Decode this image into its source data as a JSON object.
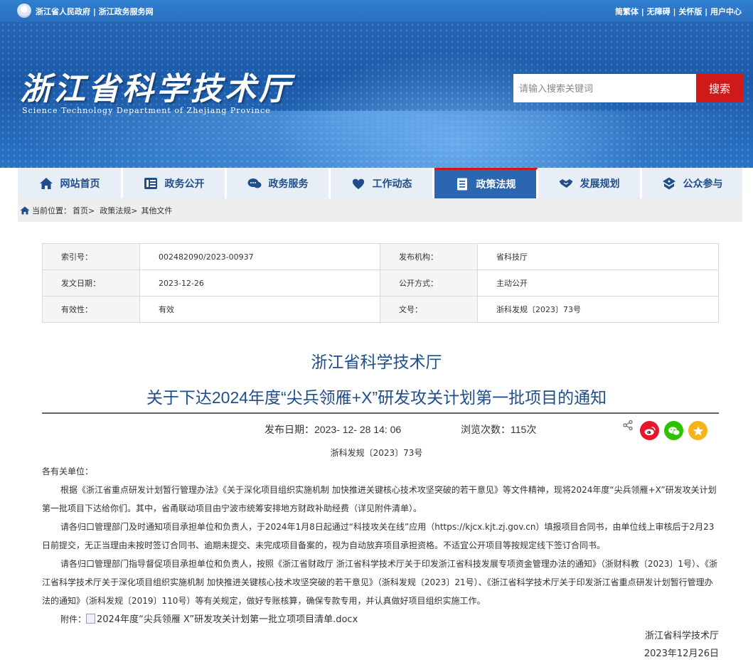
{
  "topbar": {
    "left_text": "浙江省人民政府 | 浙江政务服务网",
    "right_text": "简繁体 | 无障碍 | 关怀版 | 用户中心"
  },
  "banner": {
    "title": "浙江省科学技术厅",
    "subtitle": "Science Technology Department of Zhejiang Province"
  },
  "search": {
    "placeholder": "请输入搜索关键词",
    "button": "搜索"
  },
  "nav": {
    "items": [
      {
        "label": "网站首页",
        "icon": "home-icon"
      },
      {
        "label": "政务公开",
        "icon": "open-gov-icon"
      },
      {
        "label": "政务服务",
        "icon": "service-icon"
      },
      {
        "label": "工作动态",
        "icon": "heart-icon"
      },
      {
        "label": "政策法规",
        "icon": "document-icon"
      },
      {
        "label": "发展规划",
        "icon": "handshake-icon"
      },
      {
        "label": "公众参与",
        "icon": "participation-icon"
      }
    ],
    "active": "政策法规"
  },
  "breadcrumb": {
    "prefix": "当前位置：",
    "items": [
      "首页>",
      "政策法规>",
      "其他文件"
    ]
  },
  "info_table": {
    "rows": [
      [
        "索引号：",
        "002482090/2023-00937",
        "发布机构：",
        "省科技厅"
      ],
      [
        "发文日期：",
        "2023-12-26",
        "公开方式：",
        "主动公开"
      ],
      [
        "有效性：",
        "有效",
        "文号：",
        "浙科发规〔2023〕73号"
      ]
    ]
  },
  "article": {
    "org_title": "浙江省科学技术厅",
    "title": "关于下达2024年度“尖兵领雁+X”研发攻关计划第一批项目的通知",
    "publish_label": "发布日期：",
    "publish_date": "2023- 12- 28 14: 06",
    "views_label": "浏览次数：",
    "views": "115次",
    "doc_no": "浙科发规〔2023〕73号",
    "salutation": "各有关单位：",
    "para1": "根据《浙江省重点研发计划暂行管理办法》《关于深化项目组织实施机制 加快推进关键核心技术攻坚突破的若干意见》等文件精神，现将2024年度“尖兵领雁+X”研发攻关计划第一批项目下达给你们。其中，省甬联动项目由宁波市统筹安排地方财政补助经费（详见附件清单）。",
    "para2": "请各归口管理部门及时通知项目承担单位和负责人，于2024年1月8日起通过“科技攻关在线”应用（https://kjcx.kjt.zj.gov.cn）填报项目合同书，由单位线上审核后于2月23日前提交，无正当理由未按时签订合同书、逾期未提交、未完成项目备案的，视为自动放弃项目承担资格。不适宜公开项目等按规定线下签订合同书。",
    "para3": "请各归口管理部门指导督促项目承担单位和负责人，按照《浙江省财政厅 浙江省科学技术厅关于印发浙江省科技发展专项资金管理办法的通知》（浙财科教〔2023〕1号）、《浙江省科学技术厅关于深化项目组织实施机制 加快推进关键核心技术攻坚突破的若干意见》（浙科发规〔2023〕21号）、《浙江省科学技术厅关于印发浙江省重点研发计划暂行管理办法的通知》（浙科发规〔2019〕110号）等有关规定，做好专账核算，确保专款专用，并认真做好项目组织实施工作。",
    "attachment_label": "附件：",
    "attachment_file": "2024年度“尖兵领雁 X”研发攻关计划第一批立项项目清单.docx",
    "sign_org": "浙江省科学技术厅",
    "sign_date": "2023年12月26日"
  },
  "colors": {
    "brand_blue": "#1f4e8a",
    "nav_active": "#2a67b0",
    "search_red": "#d01a1a",
    "weibo": "#e6162d",
    "wechat": "#2dc100",
    "favorite": "#f5b31a"
  }
}
